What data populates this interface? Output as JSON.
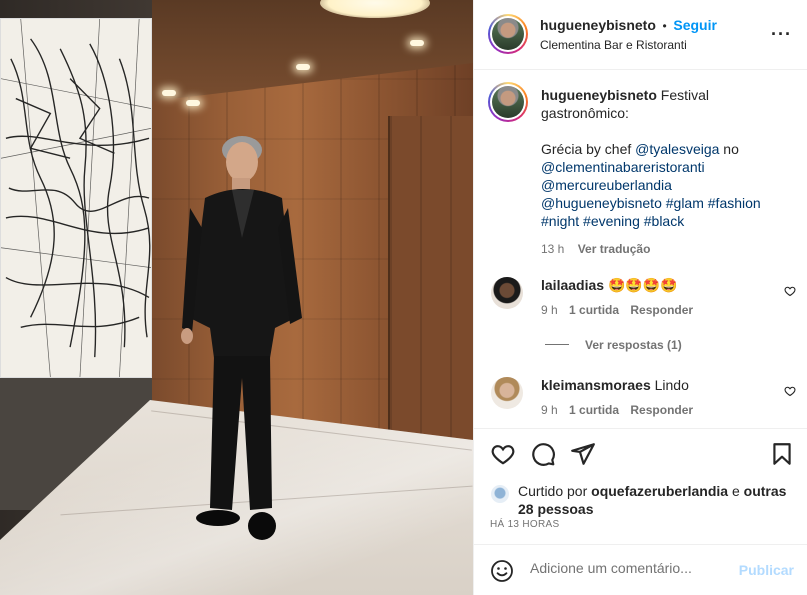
{
  "header": {
    "username": "hugueneybisneto",
    "separator": "•",
    "follow_label": "Seguir",
    "location": "Clementina Bar e Ristoranti",
    "more_icon": "more-horizontal-icon"
  },
  "caption": {
    "username": "hugueneybisneto",
    "line1": "Festival gastronômico:",
    "line2_prefix": "Grécia by chef ",
    "mention_chef": "@tyalesveiga",
    "line2_suffix": " no",
    "mention_place": "@clementinabareristoranti",
    "mention_hotel": "@mercureuberlandia",
    "tags_line1_mention": "@hugueneybisneto",
    "tags_line1_rest": " #glam #fashion",
    "tags_line2": "#night #evening #black",
    "time": "13 h",
    "translate": "Ver tradução"
  },
  "comments": [
    {
      "username": "lailaadias",
      "text": "🤩🤩🤩🤩",
      "time": "9 h",
      "likes": "1 curtida",
      "reply": "Responder",
      "view_replies": "Ver respostas (1)"
    },
    {
      "username": "kleimansmoraes",
      "text": "Lindo",
      "time": "9 h",
      "likes": "1 curtida",
      "reply": "Responder"
    }
  ],
  "actions": {
    "like_icon": "heart-icon",
    "comment_icon": "comment-icon",
    "share_icon": "send-icon",
    "save_icon": "bookmark-icon"
  },
  "likes": {
    "prefix": "Curtido por",
    "user": "oquefazeruberlandia",
    "middle": " e ",
    "others": "outras 28 pessoas"
  },
  "posted_ago": "HÁ 13 HORAS",
  "comment_box": {
    "placeholder": "Adicione um comentário...",
    "publish_label": "Publicar"
  },
  "colors": {
    "accent": "#0095f6",
    "link": "#00376b",
    "muted": "#737373",
    "publish_disabled": "#b3dbff"
  }
}
